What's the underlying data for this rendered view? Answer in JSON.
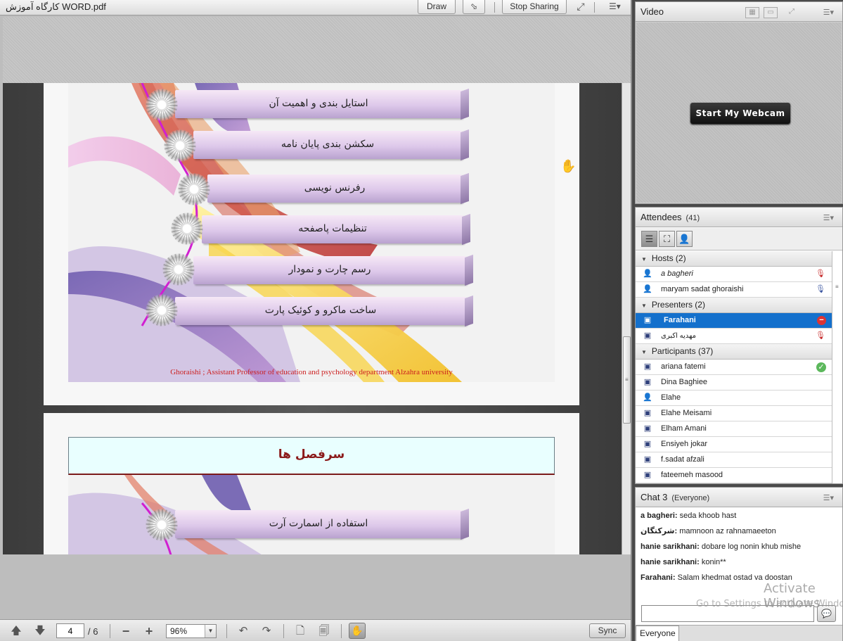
{
  "share": {
    "title": "کارگاه آموزش WORD.pdf",
    "draw_label": "Draw",
    "stop_label": "Stop Sharing",
    "pointer_icon": "pointer-icon",
    "fullscreen_icon": "fullscreen-icon"
  },
  "slide1": {
    "items": [
      "استایل بندی و اهمیت آن",
      "سکشن بندی پایان نامه",
      "رفرنس نویسی",
      "تنظیمات پاصفحه",
      "رسم چارت و نمودار",
      "ساخت ماکرو و کوئیک پارت"
    ],
    "footer": "Ghoraishi ; Assistant Professor of education and psychology department Alzahra university"
  },
  "slide2": {
    "title": "سرفصل ها",
    "items": [
      "استفاده از اسمارت آرت"
    ]
  },
  "toolbar": {
    "page": "4",
    "total": "/ 6",
    "zoom": "96%",
    "sync_label": "Sync"
  },
  "video": {
    "title": "Video",
    "webcam_label": "Start My Webcam"
  },
  "attendees": {
    "title": "Attendees",
    "count": "(41)",
    "groups": [
      {
        "label": "Hosts (2)",
        "rows": [
          {
            "name": "a bagheri",
            "status": "mic-muted"
          },
          {
            "name": "maryam sadat ghoraishi",
            "status": "mic-on"
          }
        ]
      },
      {
        "label": "Presenters (2)",
        "rows": [
          {
            "name": "Farahani",
            "status": "blocked",
            "selected": true
          },
          {
            "name": "مهدیه اکبری",
            "status": "mic-muted"
          }
        ]
      },
      {
        "label": "Participants (37)",
        "rows": [
          {
            "name": "ariana fatemi",
            "status": "agree"
          },
          {
            "name": "Dina Baghiee",
            "status": ""
          },
          {
            "name": "Elahe",
            "status": ""
          },
          {
            "name": "Elahe Meisami",
            "status": ""
          },
          {
            "name": "Elham Amani",
            "status": ""
          },
          {
            "name": "Ensiyeh jokar",
            "status": ""
          },
          {
            "name": "f.sadat afzali",
            "status": ""
          },
          {
            "name": "fateemeh masood",
            "status": ""
          }
        ]
      }
    ]
  },
  "chat": {
    "title": "Chat 3",
    "scope": "(Everyone)",
    "messages": [
      {
        "from": "a bagheri:",
        "text": "seda khoob hast"
      },
      {
        "from": "شرکتگان:",
        "text": "mamnoon az rahnamaeeton"
      },
      {
        "from": "hanie sarikhani:",
        "text": "dobare log nonin khub mishe"
      },
      {
        "from": "hanie sarikhani:",
        "text": "konin**"
      },
      {
        "from": "Farahani:",
        "text": "Salam khedmat ostad va doostan"
      }
    ],
    "tab_label": "Everyone"
  },
  "watermark": {
    "title": "Activate Windows",
    "subtitle": "Go to Settings to activate Windows."
  }
}
